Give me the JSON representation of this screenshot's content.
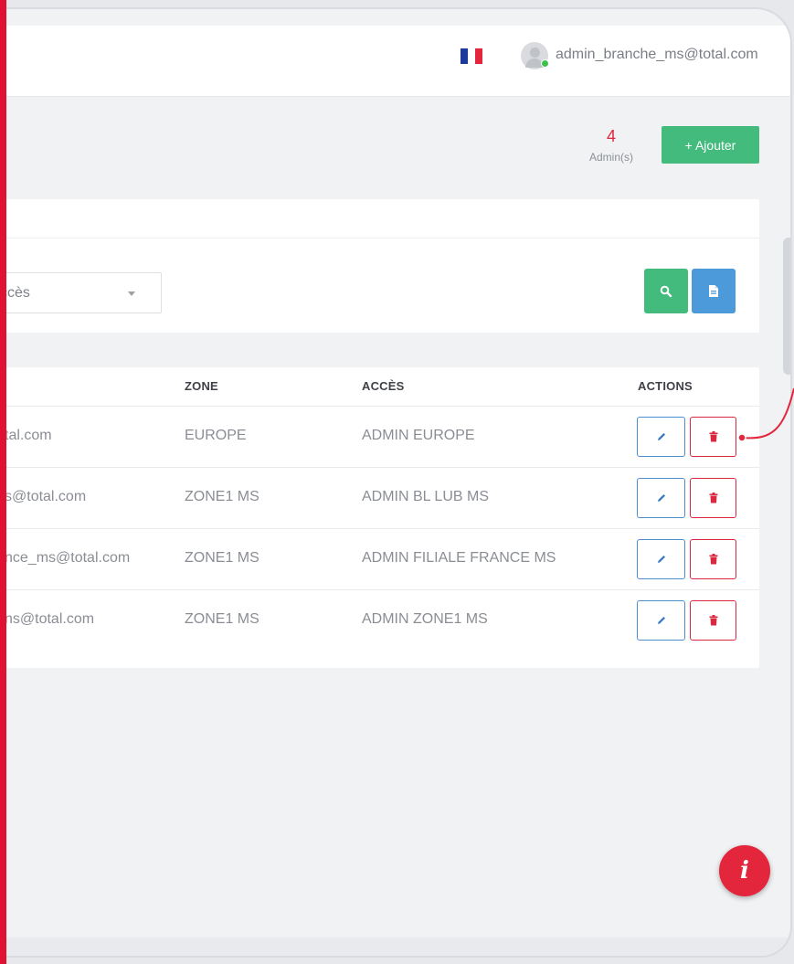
{
  "header": {
    "user_email": "admin_branche_ms@total.com",
    "flag_colors": [
      "#1c3a9b",
      "#ffffff",
      "#e3263c"
    ]
  },
  "summary": {
    "count": "4",
    "count_label": "Admin(s)",
    "add_label": "+ Ajouter"
  },
  "filters": {
    "access_select_value": "ccès"
  },
  "table": {
    "columns": {
      "zone": "ZONE",
      "access": "ACCÈS",
      "actions": "ACTIONS"
    },
    "rows": [
      {
        "email": "tal.com",
        "zone": "EUROPE",
        "access": "ADMIN EUROPE"
      },
      {
        "email": "s@total.com",
        "zone": "ZONE1 MS",
        "access": "ADMIN BL LUB MS"
      },
      {
        "email": "nce_ms@total.com",
        "zone": "ZONE1 MS",
        "access": "ADMIN FILIALE FRANCE MS"
      },
      {
        "email": "ns@total.com",
        "zone": "ZONE1 MS",
        "access": "ADMIN ZONE1 MS"
      }
    ]
  },
  "icons": {
    "search": "search-icon",
    "export": "file-icon",
    "edit": "pencil-icon",
    "delete": "trash-icon",
    "info": "i"
  },
  "colors": {
    "accent_red": "#e3263c",
    "success_green": "#43bb7d",
    "primary_blue": "#4c9ad9"
  }
}
